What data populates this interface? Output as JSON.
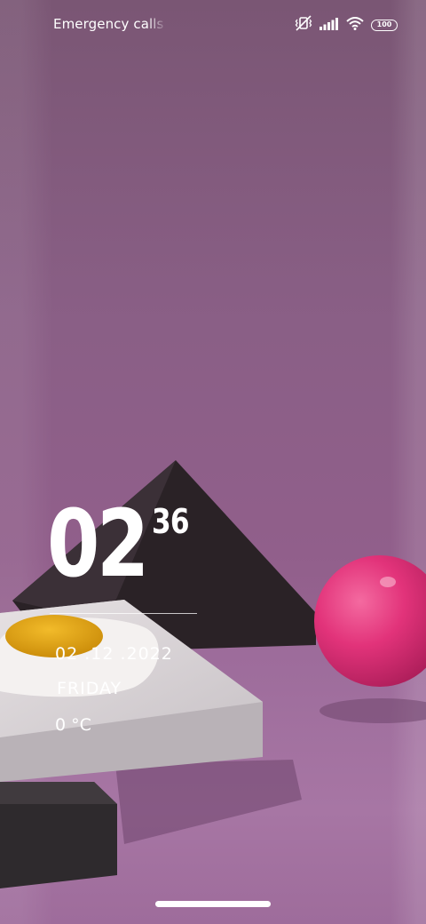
{
  "status_bar": {
    "carrier_text": "Emergency calls only",
    "battery_level": "100",
    "icons": [
      "vibrate-off-icon",
      "signal-icon",
      "wifi-icon",
      "battery-icon"
    ]
  },
  "clock": {
    "hours": "02",
    "minutes": "36",
    "date": "02 .12 .2022",
    "day": "FRIDAY",
    "temperature": "0  °C"
  },
  "wallpaper": {
    "description_colors": {
      "wall": "#8a5f86",
      "ball": "#e0397a",
      "pyramid": "#2a2226",
      "egg_yolk": "#e2a312"
    }
  }
}
